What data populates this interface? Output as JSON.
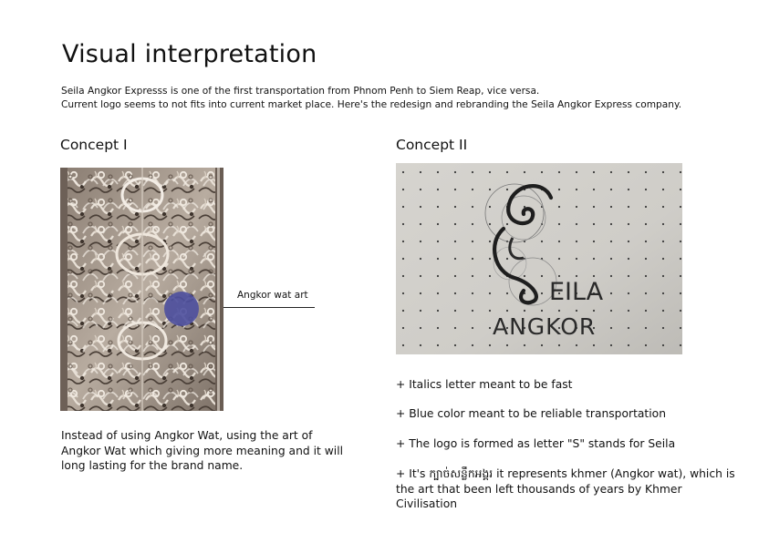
{
  "page": {
    "title": "Visual interpretation",
    "intro_line1": "Seila Angkor Expresss is one of the first transportation from Phnom Penh to Siem Reap, vice versa.",
    "intro_line2": "Current logo seems to not fits into current market place. Here's the redesign and rebranding the Seila Angkor Express company."
  },
  "concept1": {
    "heading": "Concept I",
    "annotation": "Angkor wat art",
    "description": "Instead of using Angkor Wat, using the art of Angkor Wat which giving more meaning and it will long lasting for the brand name.",
    "accent_color": "#4d4f9e"
  },
  "concept2": {
    "heading": "Concept II",
    "sketch_text_line1": "EILA",
    "sketch_text_line2": "ANGKOR",
    "bullets": [
      "+ Italics letter meant to be fast",
      "+ Blue color meant to be reliable transportation",
      "+ The logo is formed as letter \"S\" stands for Seila",
      "+ It's ក្បាច់សន្លឹកអង្គរ it represents khmer (Angkor wat), which is the art that been left thousands of years by Khmer Civilisation"
    ]
  }
}
